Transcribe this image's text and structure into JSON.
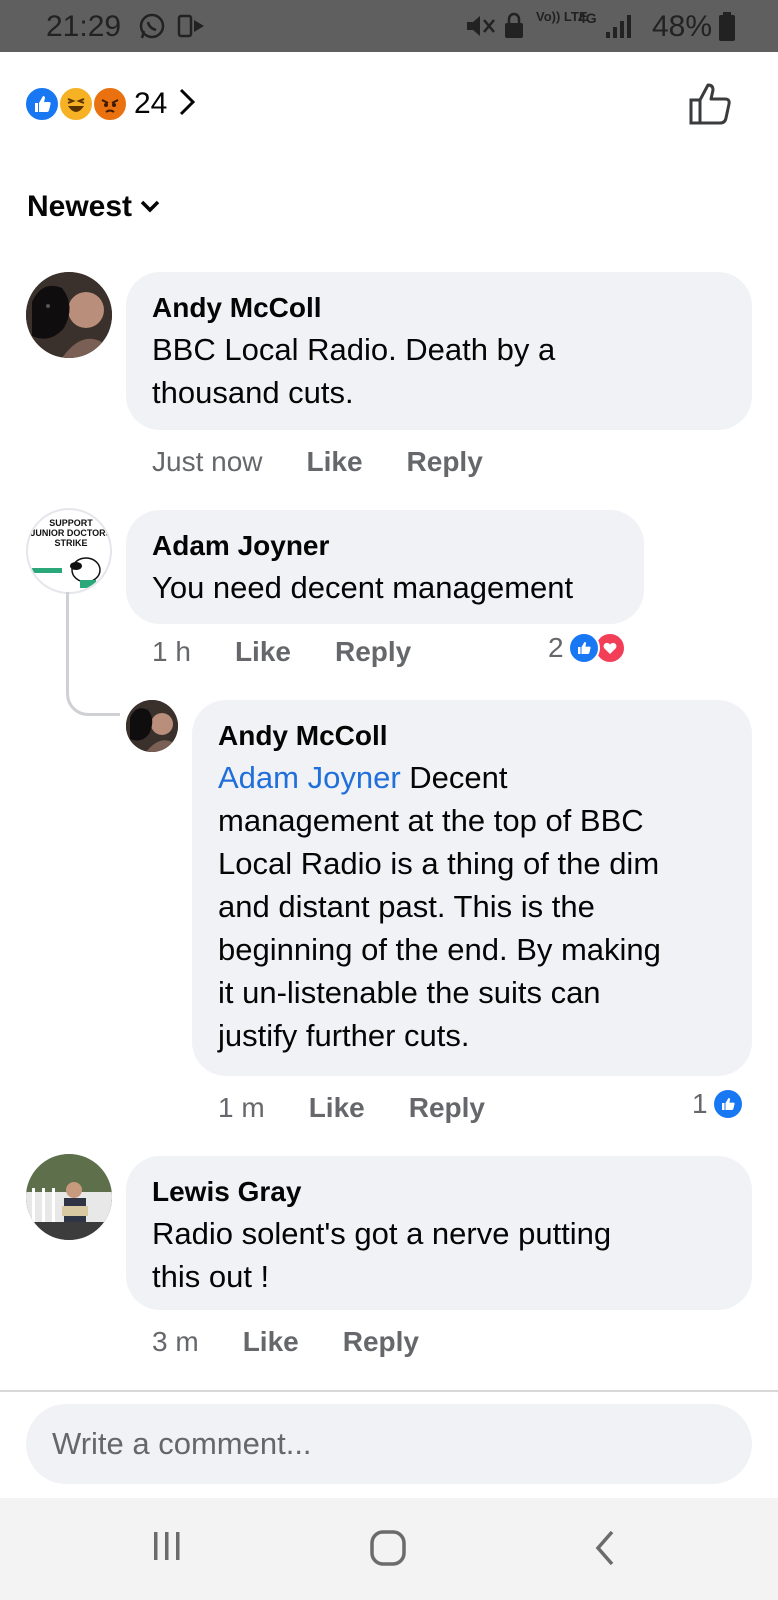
{
  "status_bar": {
    "time": "21:29",
    "battery": "48%",
    "network": "4G",
    "volte": "Vo)) LTE",
    "icons": [
      "whatsapp-icon",
      "cast-icon",
      "mute-icon",
      "lock-icon",
      "signal-icon",
      "battery-icon"
    ]
  },
  "reactions": {
    "count": "24",
    "types": [
      "like",
      "haha",
      "angry"
    ],
    "colors": {
      "like": "#1877f2",
      "haha": "#f7b125",
      "angry": "#e9710f"
    }
  },
  "sort": {
    "label": "Newest"
  },
  "comments": [
    {
      "author": "Andy McColl",
      "text_lines": [
        "BBC Local Radio. Death by a",
        "thousand cuts."
      ],
      "time": "Just now",
      "like_label": "Like",
      "reply_label": "Reply"
    },
    {
      "author": "Adam Joyner",
      "avatar_text": [
        "SUPPORT",
        "JUNIOR DOCTORS",
        "STRIKE"
      ],
      "text_lines": [
        "You need decent management"
      ],
      "time": "1 h",
      "like_label": "Like",
      "reply_label": "Reply",
      "reaction_count": "2",
      "reply": {
        "author": "Andy McColl",
        "mention": "Adam Joyner",
        "first_line_rest": " Decent",
        "text_lines": [
          "management at the top of BBC",
          "Local Radio is a thing of the dim",
          "and distant past. This is the",
          "beginning of the end. By making",
          "it un-listenable the suits can",
          "justify further cuts."
        ],
        "time": "1 m",
        "like_label": "Like",
        "reply_label": "Reply",
        "reaction_count": "1"
      }
    },
    {
      "author": "Lewis Gray",
      "text_lines": [
        "Radio solent's got a nerve putting",
        "this out !"
      ],
      "time": "3 m",
      "like_label": "Like",
      "reply_label": "Reply"
    }
  ],
  "composer": {
    "placeholder": "Write a comment..."
  },
  "nav_bar": {
    "buttons": [
      "recent-apps-icon",
      "home-icon",
      "back-icon"
    ]
  }
}
